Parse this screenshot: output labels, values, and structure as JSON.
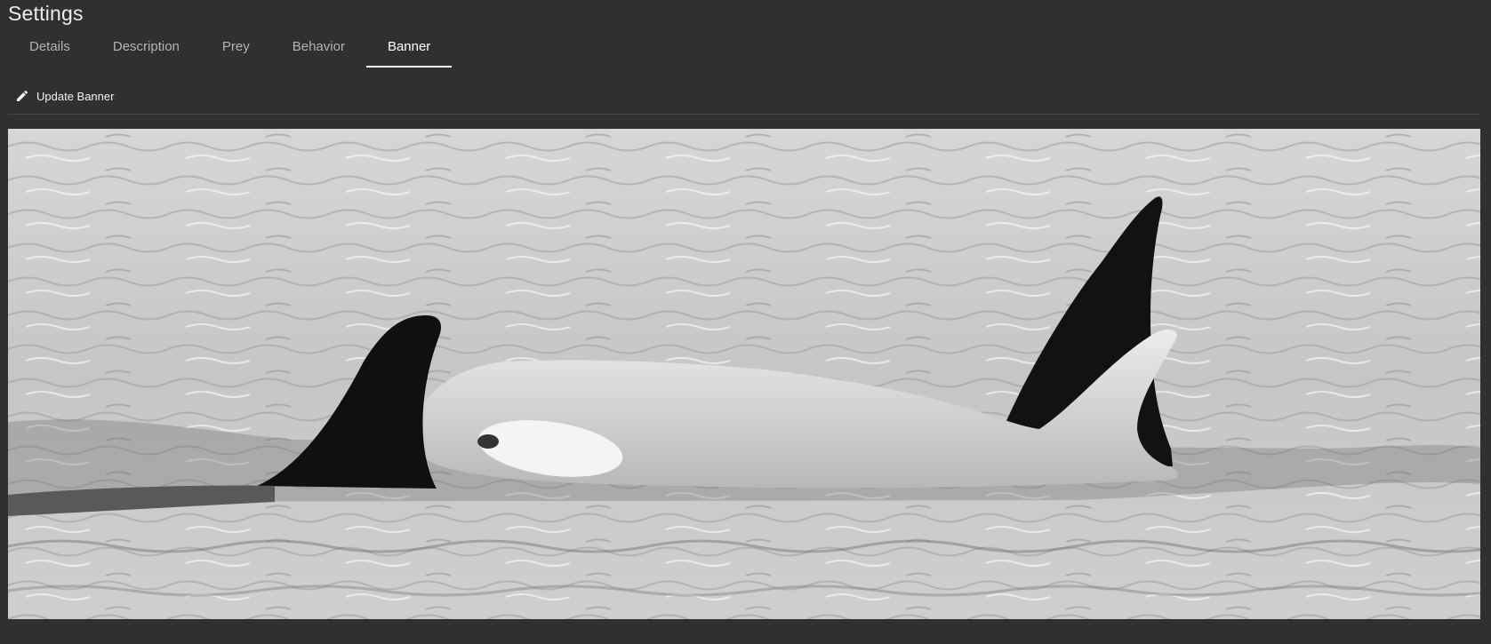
{
  "page": {
    "title": "Settings"
  },
  "tabs": [
    {
      "label": "Details",
      "active": false
    },
    {
      "label": "Description",
      "active": false
    },
    {
      "label": "Prey",
      "active": false
    },
    {
      "label": "Behavior",
      "active": false
    },
    {
      "label": "Banner",
      "active": true
    }
  ],
  "toolbar": {
    "update_label": "Update Banner",
    "update_icon": "pencil-icon"
  },
  "banner": {
    "subject": "orca-banner-photo",
    "colors": {
      "background": "#303030",
      "active_tab": "#ffffff",
      "inactive_tab": "#b4b4b4"
    }
  }
}
